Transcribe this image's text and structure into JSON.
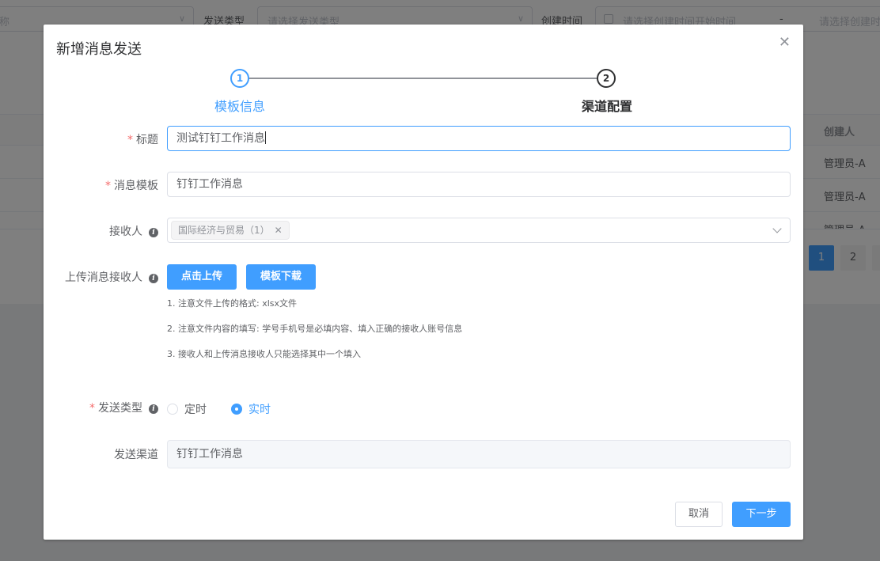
{
  "background": {
    "filter": {
      "name_placeholder_tail": "称",
      "send_type_label": "发送类型",
      "send_type_placeholder": "请选择发送类型",
      "create_time_label": "创建时间",
      "create_time_start_placeholder": "请选择创建时间开始时间",
      "date_separator": "-",
      "create_time_end_placeholder": "请选择创建时"
    },
    "table": {
      "header_creator": "创建人",
      "rows": [
        "管理员-A",
        "管理员-A",
        "管理员-A"
      ]
    },
    "pagination": {
      "pages": [
        "1",
        "2"
      ],
      "current": "1"
    }
  },
  "dialog": {
    "title": "新增消息发送",
    "steps": [
      {
        "number": "1",
        "title": "模板信息",
        "status": "active"
      },
      {
        "number": "2",
        "title": "渠道配置",
        "status": "pending"
      }
    ],
    "form": {
      "title_label": "标题",
      "title_value": "测试钉钉工作消息",
      "template_label": "消息模板",
      "template_value": "钉钉工作消息",
      "receiver_label": "接收人",
      "receiver_tag": "国际经济与贸易（1）",
      "upload_label": "上传消息接收人",
      "upload_button": "点击上传",
      "download_button": "模板下载",
      "notes": [
        "1. 注意文件上传的格式: xlsx文件",
        "2. 注意文件内容的填写: 学号手机号是必填内容、填入正确的接收人账号信息",
        "3. 接收人和上传消息接收人只能选择其中一个填入"
      ],
      "send_type_label": "发送类型",
      "send_type_options": [
        {
          "label": "定时",
          "checked": false
        },
        {
          "label": "实时",
          "checked": true
        }
      ],
      "channel_label": "发送渠道",
      "channel_value": "钉钉工作消息"
    },
    "footer": {
      "cancel": "取消",
      "next": "下一步"
    }
  },
  "colors": {
    "primary": "#409eff",
    "danger": "#f56c6c"
  }
}
